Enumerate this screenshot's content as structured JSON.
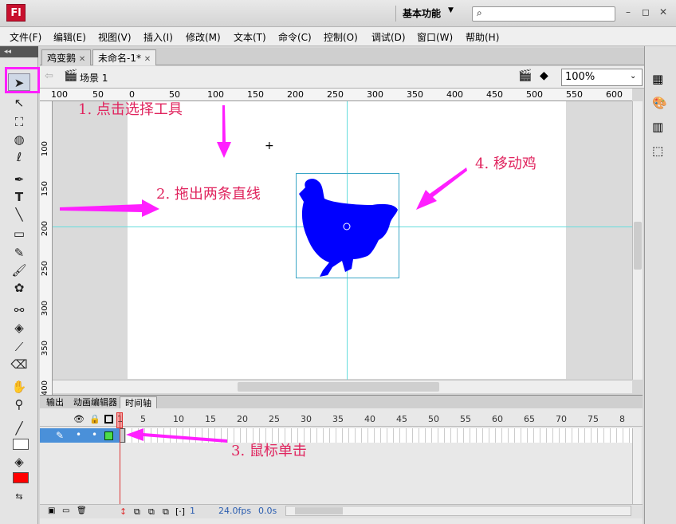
{
  "app": {
    "logo": "Fl",
    "workspace": "基本功能",
    "workspace_caret": "▼"
  },
  "window_controls": {
    "minimize": "–",
    "restore": "◻",
    "close": "✕"
  },
  "menu": [
    "文件(F)",
    "编辑(E)",
    "视图(V)",
    "插入(I)",
    "修改(M)",
    "文本(T)",
    "命令(C)",
    "控制(O)",
    "调试(D)",
    "窗口(W)",
    "帮助(H)"
  ],
  "doc_tabs": [
    {
      "label": "鸡变鹅",
      "close": "✕"
    },
    {
      "label": "未命名-1*",
      "close": "✕"
    }
  ],
  "scene": {
    "label": "场景 1",
    "zoom": "100%"
  },
  "ruler_h": [
    "100",
    "50",
    "0",
    "50",
    "100",
    "150",
    "200",
    "250",
    "300",
    "350",
    "400",
    "450",
    "500",
    "550",
    "600"
  ],
  "ruler_v": [
    "100",
    "150",
    "200",
    "250",
    "300",
    "350",
    "400"
  ],
  "panel_tabs": [
    "输出",
    "动画编辑器",
    "时间轴"
  ],
  "frame_numbers": [
    "1",
    "5",
    "10",
    "15",
    "20",
    "25",
    "30",
    "35",
    "40",
    "45",
    "50",
    "55",
    "60",
    "65",
    "70",
    "75",
    "8"
  ],
  "timeline_status": {
    "frame": "1",
    "fps": "24.0fps",
    "time": "0.0s"
  },
  "annotations": {
    "step1": "1. 点击选择工具",
    "step2": "2. 拖出两条直线",
    "step3": "3. 鼠标单击",
    "step4": "4. 移动鸡"
  },
  "colors": {
    "accent": "#ff1fff",
    "annotation": "#e0245e",
    "chicken": "#0000ff",
    "guide": "#66dddd",
    "fill": "#ff0000"
  }
}
